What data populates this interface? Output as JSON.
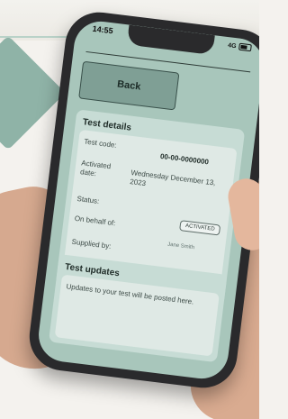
{
  "status_bar": {
    "time": "14:55",
    "network": "4G"
  },
  "app": {
    "back_label": "Back",
    "details": {
      "title": "Test details",
      "test_code_label": "Test code:",
      "test_code_value": "00-00-0000000",
      "activated_label": "Activated date:",
      "activated_value": "Wednesday December 13, 2023",
      "status_label": "Status:",
      "status_value": "ACTIVATED",
      "on_behalf_label": "On behalf of:",
      "on_behalf_value": "Jane Smith",
      "supplied_by_label": "Supplied by:"
    },
    "updates": {
      "title": "Test updates",
      "message": "Updates to your test will be posted here."
    }
  },
  "colors": {
    "screen_bg": "#a8c6bb",
    "card_bg": "#c7dcd5",
    "inner_card_bg": "#dfe9e5",
    "button_bg": "#7f9f95"
  }
}
